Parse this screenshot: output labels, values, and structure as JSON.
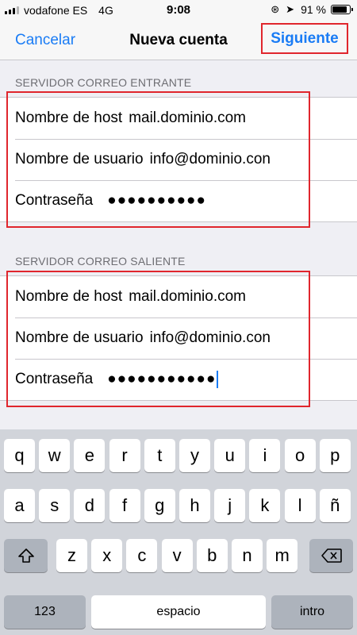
{
  "status_bar": {
    "carrier": "vodafone ES",
    "network": "4G",
    "time": "9:08",
    "battery": "91 %",
    "battery_level": 0.91
  },
  "nav": {
    "cancel": "Cancelar",
    "title": "Nueva cuenta",
    "next": "Siguiente"
  },
  "incoming": {
    "header": "SERVIDOR CORREO ENTRANTE",
    "host_label": "Nombre de host",
    "host_value": "mail.dominio.com",
    "user_label": "Nombre de usuario",
    "user_value": "info@dominio.con",
    "password_label": "Contraseña",
    "password_value": "●●●●●●●●●●"
  },
  "outgoing": {
    "header": "SERVIDOR CORREO SALIENTE",
    "host_label": "Nombre de host",
    "host_value": "mail.dominio.com",
    "user_label": "Nombre de usuario",
    "user_value": "info@dominio.con",
    "password_label": "Contraseña",
    "password_value": "●●●●●●●●●●●"
  },
  "keyboard": {
    "row1": [
      "q",
      "w",
      "e",
      "r",
      "t",
      "y",
      "u",
      "i",
      "o",
      "p"
    ],
    "row2": [
      "a",
      "s",
      "d",
      "f",
      "g",
      "h",
      "j",
      "k",
      "l",
      "ñ"
    ],
    "row3": [
      "z",
      "x",
      "c",
      "v",
      "b",
      "n",
      "m"
    ],
    "numbers_key": "123",
    "space_key": "espacio",
    "return_key": "intro"
  },
  "colors": {
    "accent": "#1a7cf5",
    "highlight": "#e0262d"
  }
}
